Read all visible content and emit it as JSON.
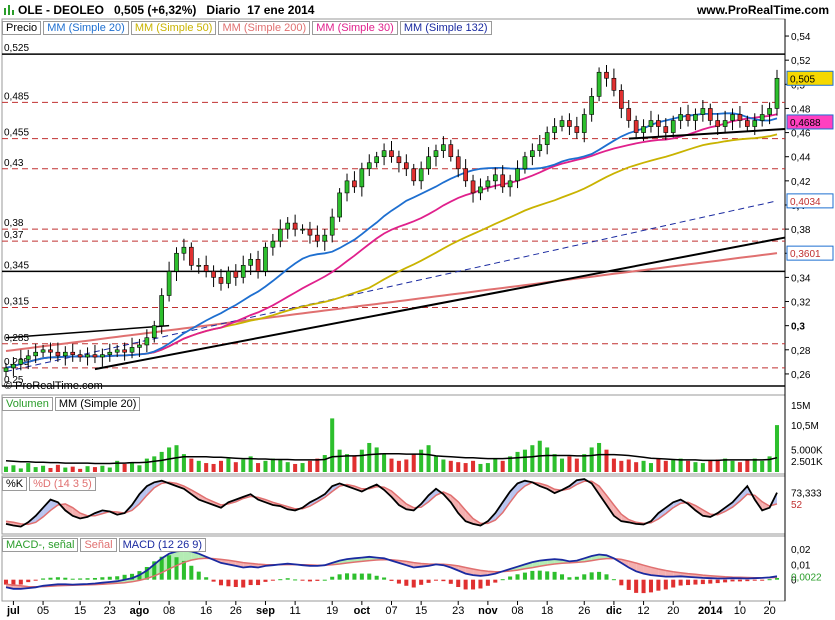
{
  "header": {
    "title": "OLE - DEOLEO   0,505 (+6,32%)   Diario  17 ene 2014",
    "website": "www.ProRealTime.com",
    "copyright": "© ProRealTime.com"
  },
  "panels": {
    "price": {
      "legend": [
        "Precio",
        "MM (Simple 20)",
        "MM (Simple 50)",
        "MM (Simple 200)",
        "MM (Simple 30)",
        "MM (Simple 132)"
      ],
      "legend_colors": [
        "#000000",
        "#1e6fd0",
        "#c9b300",
        "#e07070",
        "#e0208c",
        "#1a2aa0"
      ],
      "axis_ticks": [
        "0,54",
        "0,52",
        "0,5",
        "0,48",
        "0,46",
        "0,44",
        "0,42",
        "0,4",
        "0,38",
        "0,36",
        "0,34",
        "0,32",
        "0,3",
        "0,28",
        "0,26"
      ],
      "level_labels": [
        "0,525",
        "0,485",
        "0,455",
        "0,43",
        "0,38",
        "0,37",
        "0,345",
        "0,315",
        "0,285",
        "0,265",
        "0,25"
      ],
      "value_tags": [
        {
          "text": "0,505",
          "bg": "#f5d800"
        },
        {
          "text": "0,4688",
          "bg": "#ff40c0"
        },
        {
          "text": "0,4034",
          "bg": "#ffffff"
        },
        {
          "text": "0,3601",
          "bg": "#ffffff"
        }
      ]
    },
    "volume": {
      "legend": [
        "Volumen",
        "MM (Simple 20)"
      ],
      "axis_ticks": [
        "15M",
        "10,5M",
        "5.000K",
        "2.501K"
      ]
    },
    "stochastic": {
      "legend": [
        "%K",
        "%D (14 3 5)"
      ],
      "axis_ticks": [
        "73,333",
        "52"
      ]
    },
    "macd": {
      "legend": [
        "MACD-, señal",
        "Señal",
        "MACD (12 26 9)"
      ],
      "axis_ticks": [
        "0,02",
        "0,01",
        "0",
        "0,0022"
      ]
    },
    "xaxis": {
      "labels": [
        "jul",
        "05",
        "15",
        "23",
        "ago",
        "08",
        "16",
        "26",
        "sep",
        "11",
        "19",
        "oct",
        "07",
        "15",
        "23",
        "nov",
        "08",
        "18",
        "26",
        "dic",
        "12",
        "20",
        "2014",
        "10",
        "20"
      ]
    }
  },
  "chart_data": {
    "type": "line",
    "title": "OLE - DEOLEO",
    "price_ylim": [
      0.25,
      0.545
    ],
    "closes": [
      0.265,
      0.268,
      0.272,
      0.275,
      0.278,
      0.28,
      0.278,
      0.275,
      0.278,
      0.276,
      0.274,
      0.276,
      0.274,
      0.276,
      0.278,
      0.28,
      0.278,
      0.282,
      0.284,
      0.29,
      0.3,
      0.325,
      0.345,
      0.36,
      0.365,
      0.35,
      0.35,
      0.345,
      0.34,
      0.335,
      0.345,
      0.34,
      0.35,
      0.355,
      0.345,
      0.365,
      0.37,
      0.38,
      0.385,
      0.38,
      0.38,
      0.375,
      0.37,
      0.375,
      0.39,
      0.41,
      0.42,
      0.415,
      0.43,
      0.435,
      0.44,
      0.445,
      0.44,
      0.435,
      0.43,
      0.42,
      0.43,
      0.44,
      0.445,
      0.45,
      0.44,
      0.43,
      0.42,
      0.41,
      0.415,
      0.42,
      0.425,
      0.415,
      0.42,
      0.43,
      0.44,
      0.445,
      0.45,
      0.46,
      0.465,
      0.47,
      0.465,
      0.46,
      0.475,
      0.49,
      0.51,
      0.505,
      0.495,
      0.48,
      0.47,
      0.46,
      0.465,
      0.47,
      0.465,
      0.46,
      0.47,
      0.475,
      0.47,
      0.475,
      0.48,
      0.47,
      0.465,
      0.47,
      0.475,
      0.47,
      0.465,
      0.47,
      0.475,
      0.48,
      0.505
    ],
    "series": [
      {
        "name": "MM (Simple 20)",
        "color": "#1e6fd0"
      },
      {
        "name": "MM (Simple 50)",
        "color": "#c9b300"
      },
      {
        "name": "MM (Simple 200)",
        "color": "#e07070"
      },
      {
        "name": "MM (Simple 30)",
        "color": "#e0208c"
      },
      {
        "name": "MM (Simple 132)",
        "color": "#1a2aa0"
      }
    ],
    "levels": [
      0.525,
      0.485,
      0.455,
      0.43,
      0.38,
      0.37,
      0.345,
      0.315,
      0.285,
      0.265,
      0.25
    ],
    "volume_ylim": [
      0,
      15
    ],
    "volume": [
      1.2,
      1.5,
      0.8,
      2.0,
      1.1,
      1.4,
      0.9,
      1.6,
      1.0,
      1.2,
      0.7,
      1.3,
      1.1,
      1.4,
      1.0,
      2.5,
      1.8,
      2.2,
      1.5,
      3.0,
      3.5,
      4.5,
      5.5,
      6.0,
      4.0,
      3.0,
      2.5,
      2.0,
      1.8,
      2.5,
      3.0,
      2.2,
      2.8,
      3.5,
      2.0,
      2.5,
      3.0,
      2.8,
      2.2,
      1.8,
      2.0,
      2.5,
      3.0,
      3.8,
      12.0,
      5.0,
      4.0,
      3.5,
      5.0,
      6.5,
      5.5,
      4.0,
      3.0,
      2.5,
      2.8,
      4.0,
      5.0,
      6.0,
      3.5,
      2.8,
      2.5,
      2.2,
      2.0,
      2.5,
      1.8,
      2.0,
      3.0,
      2.5,
      3.5,
      4.5,
      5.0,
      6.0,
      7.0,
      5.5,
      4.0,
      3.0,
      3.5,
      3.0,
      4.0,
      5.5,
      6.5,
      5.0,
      3.0,
      2.5,
      2.8,
      2.2,
      2.5,
      2.0,
      3.0,
      2.5,
      2.8,
      3.0,
      2.5,
      2.2,
      2.0,
      2.5,
      2.8,
      3.0,
      2.5,
      2.2,
      2.8,
      3.0,
      2.5,
      3.5,
      10.5
    ],
    "volume_ma": [
      2.5,
      2.4,
      2.3,
      2.3,
      2.2,
      2.2,
      2.1,
      2.1,
      2.0,
      2.0,
      2.0,
      2.0,
      1.9,
      1.9,
      1.9,
      2.0,
      2.0,
      2.1,
      2.1,
      2.2,
      2.4,
      2.6,
      2.9,
      3.2,
      3.4,
      3.4,
      3.4,
      3.4,
      3.3,
      3.3,
      3.2,
      3.1,
      3.0,
      3.0,
      2.9,
      2.9,
      2.8,
      2.8,
      2.8,
      2.7,
      2.7,
      2.7,
      2.7,
      2.8,
      3.4,
      3.5,
      3.6,
      3.6,
      3.7,
      3.9,
      4.0,
      4.1,
      4.1,
      4.1,
      4.0,
      4.0,
      4.0,
      3.9,
      3.6,
      3.5,
      3.4,
      3.3,
      3.2,
      3.2,
      3.1,
      3.0,
      3.0,
      3.0,
      3.1,
      3.2,
      3.3,
      3.4,
      3.6,
      3.7,
      3.7,
      3.7,
      3.7,
      3.6,
      3.6,
      3.7,
      3.9,
      3.9,
      3.9,
      3.8,
      3.7,
      3.5,
      3.3,
      3.1,
      3.0,
      2.9,
      2.8,
      2.7,
      2.7,
      2.7,
      2.6,
      2.6,
      2.6,
      2.7,
      2.7,
      2.7,
      2.7,
      2.7,
      2.7,
      2.8,
      3.2
    ],
    "stoch_ylim": [
      0,
      100
    ],
    "stoch_k": [
      15,
      12,
      10,
      18,
      30,
      45,
      60,
      55,
      40,
      30,
      25,
      28,
      35,
      40,
      38,
      32,
      35,
      50,
      70,
      85,
      92,
      95,
      90,
      85,
      80,
      70,
      60,
      55,
      50,
      45,
      55,
      60,
      65,
      70,
      60,
      55,
      50,
      48,
      42,
      40,
      45,
      55,
      62,
      70,
      85,
      90,
      85,
      80,
      75,
      82,
      88,
      78,
      65,
      50,
      42,
      40,
      52,
      68,
      80,
      70,
      55,
      35,
      20,
      15,
      12,
      20,
      35,
      55,
      75,
      90,
      95,
      92,
      85,
      80,
      72,
      78,
      85,
      96,
      98,
      90,
      70,
      50,
      30,
      20,
      18,
      15,
      14,
      20,
      35,
      45,
      55,
      60,
      52,
      40,
      30,
      28,
      35,
      45,
      55,
      70,
      85,
      60,
      40,
      45,
      73
    ],
    "stoch_d": [
      20,
      18,
      15,
      14,
      18,
      28,
      40,
      50,
      52,
      45,
      35,
      30,
      30,
      34,
      38,
      37,
      35,
      40,
      52,
      68,
      82,
      90,
      92,
      90,
      85,
      78,
      70,
      62,
      56,
      50,
      52,
      56,
      62,
      66,
      64,
      60,
      55,
      51,
      47,
      43,
      43,
      48,
      56,
      64,
      75,
      85,
      88,
      85,
      80,
      80,
      84,
      83,
      76,
      64,
      52,
      45,
      46,
      56,
      68,
      74,
      68,
      56,
      40,
      25,
      16,
      16,
      22,
      36,
      55,
      73,
      85,
      92,
      90,
      86,
      79,
      77,
      80,
      88,
      94,
      94,
      85,
      68,
      50,
      33,
      23,
      18,
      16,
      17,
      24,
      34,
      45,
      53,
      55,
      49,
      41,
      33,
      32,
      38,
      46,
      57,
      70,
      68,
      56,
      48,
      52
    ],
    "macd_ylim": [
      -0.012,
      0.026
    ],
    "macd": [
      -0.005,
      -0.006,
      -0.006,
      -0.0055,
      -0.005,
      -0.004,
      -0.0035,
      -0.003,
      -0.003,
      -0.0032,
      -0.003,
      -0.0028,
      -0.0025,
      -0.002,
      -0.0015,
      -0.001,
      0.0,
      0.001,
      0.003,
      0.006,
      0.01,
      0.014,
      0.017,
      0.0185,
      0.019,
      0.0185,
      0.017,
      0.015,
      0.013,
      0.011,
      0.01,
      0.009,
      0.008,
      0.0085,
      0.008,
      0.009,
      0.0095,
      0.01,
      0.0105,
      0.01,
      0.0095,
      0.009,
      0.009,
      0.0095,
      0.011,
      0.0125,
      0.0135,
      0.014,
      0.0145,
      0.015,
      0.0145,
      0.014,
      0.0125,
      0.011,
      0.0095,
      0.008,
      0.0085,
      0.009,
      0.01,
      0.0095,
      0.008,
      0.006,
      0.004,
      0.003,
      0.0025,
      0.003,
      0.004,
      0.0055,
      0.007,
      0.0085,
      0.01,
      0.0115,
      0.0125,
      0.013,
      0.0135,
      0.013,
      0.012,
      0.0125,
      0.014,
      0.0155,
      0.0165,
      0.016,
      0.014,
      0.011,
      0.008,
      0.0055,
      0.004,
      0.003,
      0.0025,
      0.002,
      0.002,
      0.0022,
      0.0018,
      0.0015,
      0.0012,
      0.001,
      0.0008,
      0.0008,
      0.001,
      0.0009,
      0.0008,
      0.001,
      0.0012,
      0.0015,
      0.0022
    ],
    "macd_signal": [
      -0.003,
      -0.0035,
      -0.004,
      -0.0045,
      -0.0046,
      -0.0045,
      -0.0043,
      -0.004,
      -0.0038,
      -0.0036,
      -0.0035,
      -0.0034,
      -0.0032,
      -0.003,
      -0.0027,
      -0.0024,
      -0.002,
      -0.0014,
      -0.0005,
      0.0008,
      0.0025,
      0.0046,
      0.007,
      0.0093,
      0.0113,
      0.0128,
      0.0137,
      0.014,
      0.0138,
      0.0133,
      0.0127,
      0.012,
      0.0112,
      0.0107,
      0.0102,
      0.0099,
      0.0098,
      0.0098,
      0.0099,
      0.0099,
      0.0098,
      0.0097,
      0.0095,
      0.0095,
      0.0098,
      0.0103,
      0.0109,
      0.0115,
      0.012,
      0.0125,
      0.0129,
      0.0131,
      0.013,
      0.0126,
      0.012,
      0.0112,
      0.0106,
      0.0103,
      0.0102,
      0.0101,
      0.0097,
      0.009,
      0.008,
      0.007,
      0.0061,
      0.0055,
      0.0052,
      0.0053,
      0.0057,
      0.0063,
      0.0071,
      0.0079,
      0.0088,
      0.0096,
      0.0103,
      0.0108,
      0.011,
      0.0113,
      0.0118,
      0.0125,
      0.0133,
      0.0138,
      0.0138,
      0.0133,
      0.0122,
      0.0109,
      0.0095,
      0.0082,
      0.007,
      0.006,
      0.0052,
      0.0046,
      0.004,
      0.0035,
      0.003,
      0.0026,
      0.0022,
      0.0019,
      0.0017,
      0.0016,
      0.0014,
      0.0013,
      0.0013,
      0.0013,
      0.0015
    ]
  }
}
